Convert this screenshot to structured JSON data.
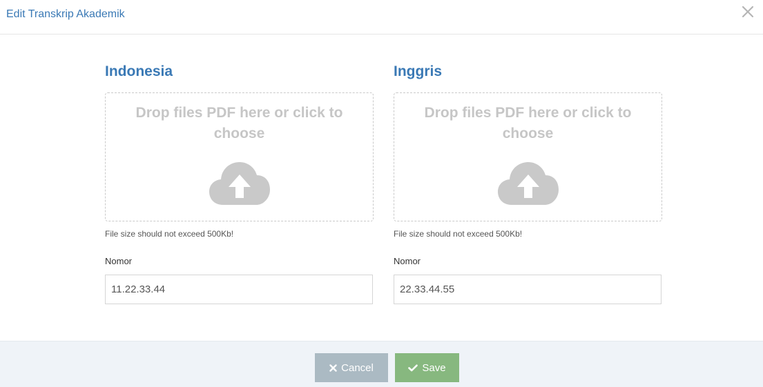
{
  "modal": {
    "title": "Edit Transkrip Akademik",
    "close_icon": "close-icon"
  },
  "columns": [
    {
      "heading": "Indonesia",
      "dropzone_message": "Drop files PDF here or click to choose",
      "dropzone_icon": "cloud-upload-icon",
      "hint": "File size should not exceed 500Kb!",
      "field_label": "Nomor",
      "field_value": "11.22.33.44"
    },
    {
      "heading": "Inggris",
      "dropzone_message": "Drop files PDF here or click to choose",
      "dropzone_icon": "cloud-upload-icon",
      "hint": "File size should not exceed 500Kb!",
      "field_label": "Nomor",
      "field_value": "22.33.44.55"
    }
  ],
  "footer": {
    "cancel_label": "Cancel",
    "save_label": "Save",
    "cancel_icon": "times-icon",
    "save_icon": "check-icon"
  },
  "colors": {
    "title": "#3a79b5",
    "cancel_button": "#abbac3",
    "save_button": "#87b87f",
    "footer_bg": "#eff3f8"
  }
}
